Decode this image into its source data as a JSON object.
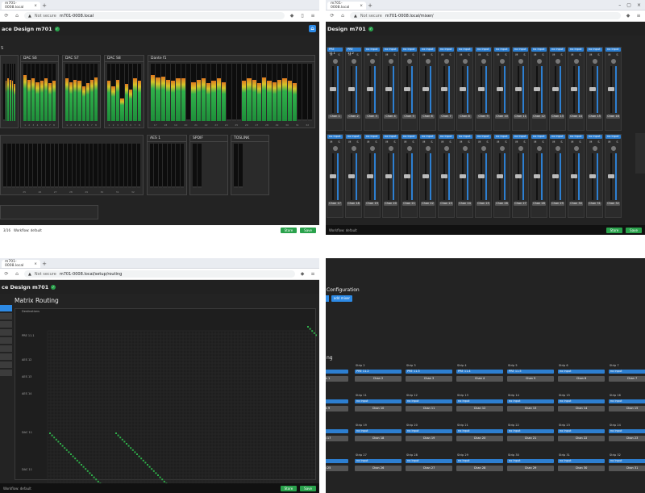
{
  "quadrants": {
    "meters": {
      "tab_title": "m701-0008.local",
      "not_secure": "Not secure",
      "url": "m701-0008.local",
      "app_title": "ace Design m701",
      "panels": [
        {
          "label": "S"
        },
        {
          "label": "DAC S6"
        },
        {
          "label": "DAC S7"
        },
        {
          "label": "DAC S8"
        },
        {
          "label": "Dante f1"
        },
        {
          "label": "AES 1"
        },
        {
          "label": "SPDIF"
        },
        {
          "label": "TOSLINK"
        }
      ],
      "channel_numbers": [
        "1",
        "2",
        "3",
        "4",
        "5",
        "6",
        "7",
        "8"
      ],
      "dante_numbers": [
        "17",
        "18",
        "19",
        "20",
        "21",
        "22",
        "23",
        "24",
        "25",
        "26",
        "27",
        "28",
        "29",
        "30",
        "31",
        "32"
      ],
      "lower_numbers": [
        "9",
        "10",
        "11",
        "12",
        "13",
        "14",
        "15",
        "16"
      ],
      "lower_numbers_b": [
        "17",
        "18",
        "19",
        "20",
        "21",
        "22",
        "23",
        "24"
      ],
      "lower_numbers_c": [
        "25",
        "26",
        "27",
        "28",
        "29",
        "30",
        "31",
        "32"
      ],
      "status_text": "3/16",
      "workflow": "Workflow: default",
      "btn_store": "Store",
      "btn_save": "Save"
    },
    "mixer": {
      "tab_title": "m701-0008.local",
      "not_secure": "Not secure",
      "url": "m701-0008.local/mixer/",
      "app_title": "Design m701",
      "chip_labels": [
        "PRE 11.1",
        "PRE 11.2",
        "no input",
        "no input",
        "no input",
        "no input",
        "no input",
        "no input",
        "no input",
        "no input",
        "no input",
        "no input",
        "no input",
        "no input",
        "no input",
        "no input"
      ],
      "mute_solo": [
        "M",
        "S"
      ],
      "chan_row1": [
        "Chan 1",
        "Chan 2",
        "Chan 3",
        "Chan 4",
        "Chan 5",
        "Chan 6",
        "Chan 7",
        "Chan 8",
        "Chan 9",
        "Chan 10",
        "Chan 11",
        "Chan 12",
        "Chan 13",
        "Chan 14",
        "Chan 15",
        "Chan 16"
      ],
      "chan_row2": [
        "Chan 17",
        "Chan 18",
        "Chan 19",
        "Chan 20",
        "Chan 21",
        "Chan 22",
        "Chan 23",
        "Chan 24",
        "Chan 25",
        "Chan 26",
        "Chan 27",
        "Chan 28",
        "Chan 29",
        "Chan 30",
        "Chan 31",
        "Chan 32"
      ],
      "workflow": "Workflow: default",
      "btn_store": "Store",
      "btn_save": "Save"
    },
    "routing": {
      "tab_title": "m701-0008.local",
      "not_secure": "Not secure",
      "url": "m701-0008.local/setup/routing",
      "app_title": "ce Design m701",
      "page_title": "Matrix Routing",
      "header_label": "Destinations",
      "row_labels": [
        "PRE 11.1",
        "AES 12",
        "AES 13",
        "AES 14",
        "DAC 11",
        "DAC 11"
      ],
      "workflow": "Workflow: default",
      "btn_store": "Store",
      "btn_save": "Save"
    },
    "config": {
      "section_title": "Configuration",
      "add_mixer_label": "add mixer",
      "strip_section": "ng",
      "strips": [
        {
          "strip": "Strip 1",
          "input": "PRE 11.1",
          "chan": "Chan 1"
        },
        {
          "strip": "Strip 2",
          "input": "PRE 11.2",
          "chan": "Chan 2"
        },
        {
          "strip": "Strip 3",
          "input": "PRE 11.3",
          "chan": "Chan 3"
        },
        {
          "strip": "Strip 4",
          "input": "PRE 11.4",
          "chan": "Chan 4"
        },
        {
          "strip": "Strip 5",
          "input": "PRE 11.5",
          "chan": "Chan 5"
        },
        {
          "strip": "Strip 6",
          "input": "no input",
          "chan": "Chan 6"
        },
        {
          "strip": "Strip 7",
          "input": "no input",
          "chan": "Chan 7"
        },
        {
          "strip": "Strip 10",
          "input": "no input",
          "chan": "Chan 9"
        },
        {
          "strip": "Strip 11",
          "input": "no input",
          "chan": "Chan 10"
        },
        {
          "strip": "Strip 12",
          "input": "no input",
          "chan": "Chan 11"
        },
        {
          "strip": "Strip 13",
          "input": "no input",
          "chan": "Chan 12"
        },
        {
          "strip": "Strip 14",
          "input": "no input",
          "chan": "Chan 13"
        },
        {
          "strip": "Strip 15",
          "input": "no input",
          "chan": "Chan 14"
        },
        {
          "strip": "Strip 16",
          "input": "no input",
          "chan": "Chan 15"
        },
        {
          "strip": "Strip 18",
          "input": "no input",
          "chan": "Chan 17"
        },
        {
          "strip": "Strip 19",
          "input": "no input",
          "chan": "Chan 18"
        },
        {
          "strip": "Strip 20",
          "input": "no input",
          "chan": "Chan 19"
        },
        {
          "strip": "Strip 21",
          "input": "no input",
          "chan": "Chan 20"
        },
        {
          "strip": "Strip 22",
          "input": "no input",
          "chan": "Chan 21"
        },
        {
          "strip": "Strip 23",
          "input": "no input",
          "chan": "Chan 22"
        },
        {
          "strip": "Strip 24",
          "input": "no input",
          "chan": "Chan 23"
        },
        {
          "strip": "Strip 26",
          "input": "no input",
          "chan": "Chan 25"
        },
        {
          "strip": "Strip 27",
          "input": "no input",
          "chan": "Chan 26"
        },
        {
          "strip": "Strip 28",
          "input": "no input",
          "chan": "Chan 27"
        },
        {
          "strip": "Strip 29",
          "input": "no input",
          "chan": "Chan 28"
        },
        {
          "strip": "Strip 30",
          "input": "no input",
          "chan": "Chan 29"
        },
        {
          "strip": "Strip 31",
          "input": "no input",
          "chan": "Chan 30"
        },
        {
          "strip": "Strip 32",
          "input": "no input",
          "chan": "Chan 31"
        }
      ]
    }
  },
  "colors": {
    "accent": "#2d8ae5",
    "green": "#2aa24c",
    "panel": "#2a2a2a",
    "bg": "#232323"
  }
}
